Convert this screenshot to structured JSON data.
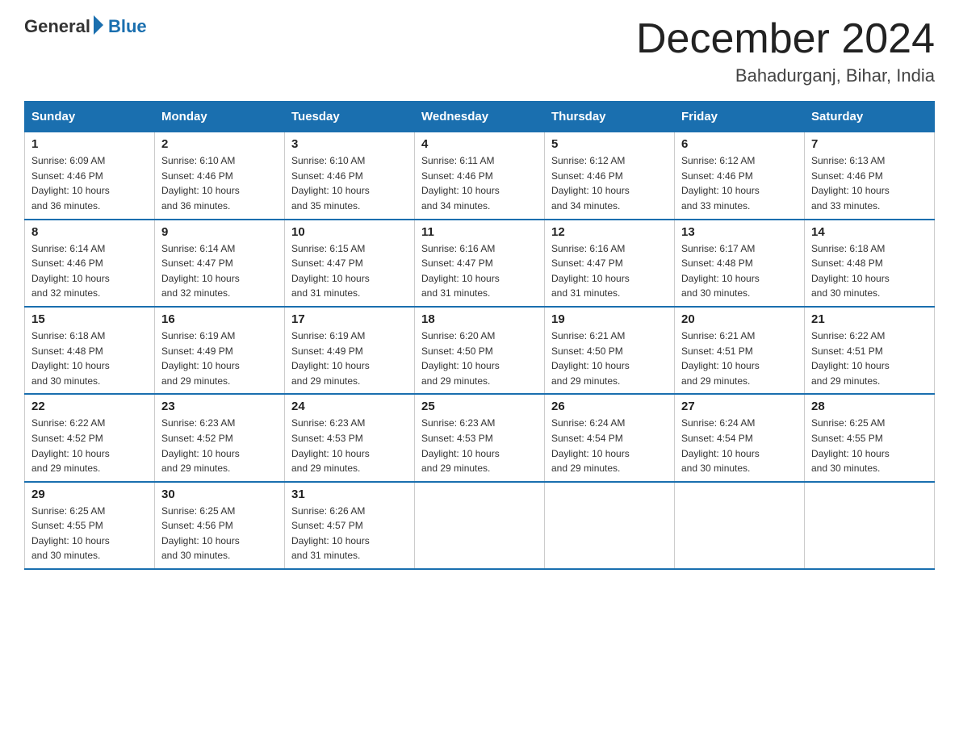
{
  "header": {
    "logo_general": "General",
    "logo_blue": "Blue",
    "month_year": "December 2024",
    "location": "Bahadurganj, Bihar, India"
  },
  "weekdays": [
    "Sunday",
    "Monday",
    "Tuesday",
    "Wednesday",
    "Thursday",
    "Friday",
    "Saturday"
  ],
  "weeks": [
    [
      {
        "day": "1",
        "sunrise": "6:09 AM",
        "sunset": "4:46 PM",
        "daylight": "10 hours and 36 minutes."
      },
      {
        "day": "2",
        "sunrise": "6:10 AM",
        "sunset": "4:46 PM",
        "daylight": "10 hours and 36 minutes."
      },
      {
        "day": "3",
        "sunrise": "6:10 AM",
        "sunset": "4:46 PM",
        "daylight": "10 hours and 35 minutes."
      },
      {
        "day": "4",
        "sunrise": "6:11 AM",
        "sunset": "4:46 PM",
        "daylight": "10 hours and 34 minutes."
      },
      {
        "day": "5",
        "sunrise": "6:12 AM",
        "sunset": "4:46 PM",
        "daylight": "10 hours and 34 minutes."
      },
      {
        "day": "6",
        "sunrise": "6:12 AM",
        "sunset": "4:46 PM",
        "daylight": "10 hours and 33 minutes."
      },
      {
        "day": "7",
        "sunrise": "6:13 AM",
        "sunset": "4:46 PM",
        "daylight": "10 hours and 33 minutes."
      }
    ],
    [
      {
        "day": "8",
        "sunrise": "6:14 AM",
        "sunset": "4:46 PM",
        "daylight": "10 hours and 32 minutes."
      },
      {
        "day": "9",
        "sunrise": "6:14 AM",
        "sunset": "4:47 PM",
        "daylight": "10 hours and 32 minutes."
      },
      {
        "day": "10",
        "sunrise": "6:15 AM",
        "sunset": "4:47 PM",
        "daylight": "10 hours and 31 minutes."
      },
      {
        "day": "11",
        "sunrise": "6:16 AM",
        "sunset": "4:47 PM",
        "daylight": "10 hours and 31 minutes."
      },
      {
        "day": "12",
        "sunrise": "6:16 AM",
        "sunset": "4:47 PM",
        "daylight": "10 hours and 31 minutes."
      },
      {
        "day": "13",
        "sunrise": "6:17 AM",
        "sunset": "4:48 PM",
        "daylight": "10 hours and 30 minutes."
      },
      {
        "day": "14",
        "sunrise": "6:18 AM",
        "sunset": "4:48 PM",
        "daylight": "10 hours and 30 minutes."
      }
    ],
    [
      {
        "day": "15",
        "sunrise": "6:18 AM",
        "sunset": "4:48 PM",
        "daylight": "10 hours and 30 minutes."
      },
      {
        "day": "16",
        "sunrise": "6:19 AM",
        "sunset": "4:49 PM",
        "daylight": "10 hours and 29 minutes."
      },
      {
        "day": "17",
        "sunrise": "6:19 AM",
        "sunset": "4:49 PM",
        "daylight": "10 hours and 29 minutes."
      },
      {
        "day": "18",
        "sunrise": "6:20 AM",
        "sunset": "4:50 PM",
        "daylight": "10 hours and 29 minutes."
      },
      {
        "day": "19",
        "sunrise": "6:21 AM",
        "sunset": "4:50 PM",
        "daylight": "10 hours and 29 minutes."
      },
      {
        "day": "20",
        "sunrise": "6:21 AM",
        "sunset": "4:51 PM",
        "daylight": "10 hours and 29 minutes."
      },
      {
        "day": "21",
        "sunrise": "6:22 AM",
        "sunset": "4:51 PM",
        "daylight": "10 hours and 29 minutes."
      }
    ],
    [
      {
        "day": "22",
        "sunrise": "6:22 AM",
        "sunset": "4:52 PM",
        "daylight": "10 hours and 29 minutes."
      },
      {
        "day": "23",
        "sunrise": "6:23 AM",
        "sunset": "4:52 PM",
        "daylight": "10 hours and 29 minutes."
      },
      {
        "day": "24",
        "sunrise": "6:23 AM",
        "sunset": "4:53 PM",
        "daylight": "10 hours and 29 minutes."
      },
      {
        "day": "25",
        "sunrise": "6:23 AM",
        "sunset": "4:53 PM",
        "daylight": "10 hours and 29 minutes."
      },
      {
        "day": "26",
        "sunrise": "6:24 AM",
        "sunset": "4:54 PM",
        "daylight": "10 hours and 29 minutes."
      },
      {
        "day": "27",
        "sunrise": "6:24 AM",
        "sunset": "4:54 PM",
        "daylight": "10 hours and 30 minutes."
      },
      {
        "day": "28",
        "sunrise": "6:25 AM",
        "sunset": "4:55 PM",
        "daylight": "10 hours and 30 minutes."
      }
    ],
    [
      {
        "day": "29",
        "sunrise": "6:25 AM",
        "sunset": "4:55 PM",
        "daylight": "10 hours and 30 minutes."
      },
      {
        "day": "30",
        "sunrise": "6:25 AM",
        "sunset": "4:56 PM",
        "daylight": "10 hours and 30 minutes."
      },
      {
        "day": "31",
        "sunrise": "6:26 AM",
        "sunset": "4:57 PM",
        "daylight": "10 hours and 31 minutes."
      },
      null,
      null,
      null,
      null
    ]
  ],
  "labels": {
    "sunrise": "Sunrise:",
    "sunset": "Sunset:",
    "daylight": "Daylight:"
  }
}
